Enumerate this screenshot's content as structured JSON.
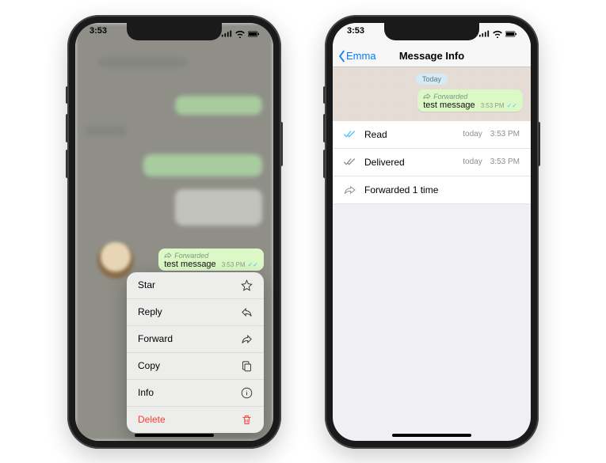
{
  "status": {
    "time": "3:53"
  },
  "left": {
    "bubble": {
      "forwarded_label": "Forwarded",
      "text": "test message",
      "time": "3:53 PM"
    },
    "menu": [
      {
        "label": "Star",
        "icon": "star-icon"
      },
      {
        "label": "Reply",
        "icon": "reply-icon"
      },
      {
        "label": "Forward",
        "icon": "forward-icon"
      },
      {
        "label": "Copy",
        "icon": "copy-icon"
      },
      {
        "label": "Info",
        "icon": "info-icon"
      },
      {
        "label": "Delete",
        "icon": "trash-icon"
      }
    ]
  },
  "right": {
    "nav": {
      "back": "Emma",
      "title": "Message Info"
    },
    "date_pill": "Today",
    "bubble": {
      "forwarded_label": "Forwarded",
      "text": "test message",
      "time": "3:53 PM"
    },
    "rows": [
      {
        "kind": "read",
        "label": "Read",
        "day": "today",
        "time": "3:53 PM"
      },
      {
        "kind": "delivered",
        "label": "Delivered",
        "day": "today",
        "time": "3:53 PM"
      },
      {
        "kind": "forwarded",
        "label": "Forwarded 1 time"
      }
    ]
  }
}
